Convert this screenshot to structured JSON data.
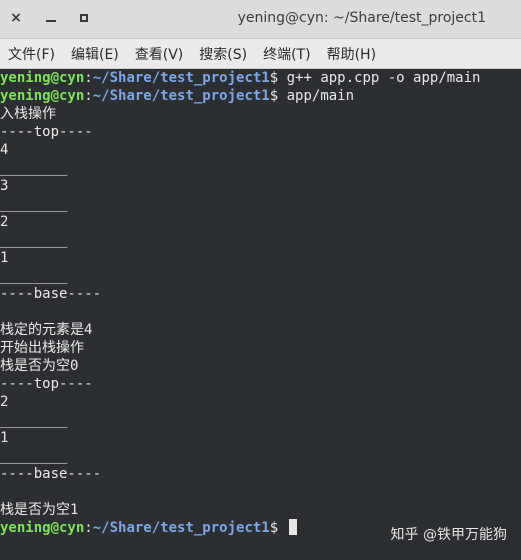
{
  "window": {
    "title": "yening@cyn: ~/Share/test_project1",
    "close_icon": "×",
    "minimize_icon": "minimize-icon",
    "maximize_icon": "maximize-icon"
  },
  "menu": {
    "items": [
      "文件(F)",
      "编辑(E)",
      "查看(V)",
      "搜索(S)",
      "终端(T)",
      "帮助(H)"
    ]
  },
  "terminal": {
    "prompt": {
      "user": "yening@cyn",
      "colon": ":",
      "path": "~/Share/test_project1",
      "dollar": "$ "
    },
    "commands": [
      "g++ app.cpp -o app/main",
      "app/main",
      ""
    ],
    "output_1": [
      "入栈操作",
      "----top----",
      "4",
      "________",
      "3",
      "________",
      "2",
      "________",
      "1",
      "________",
      "----base----",
      "",
      "栈定的元素是4",
      "开始出栈操作",
      "栈是否为空0",
      "----top----",
      "2",
      "________",
      "1",
      "________",
      "----base----",
      "",
      "栈是否为空1"
    ]
  },
  "watermark": "知乎 @铁甲万能狗",
  "colors": {
    "background": "#2c2f31",
    "user": "#7ee35a",
    "path": "#7fa6e8",
    "text": "#e9e9e9"
  }
}
